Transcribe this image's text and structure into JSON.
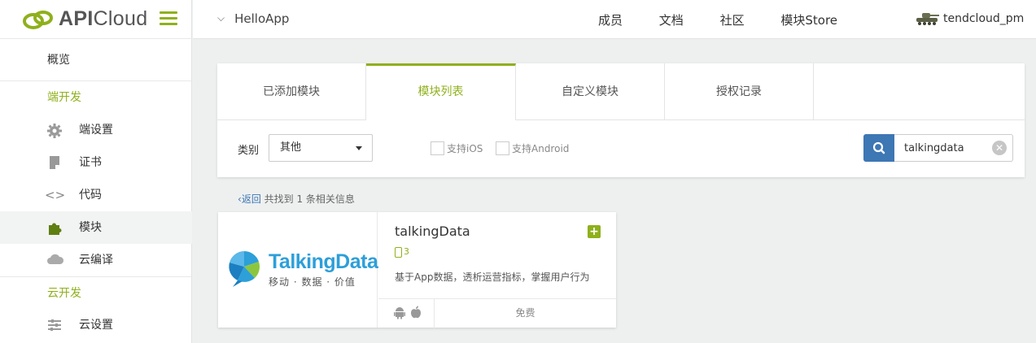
{
  "brand": {
    "logo_text_bold": "API",
    "logo_text_light": "Cloud",
    "accent": "#8fb01c"
  },
  "header": {
    "app_name": "HelloApp",
    "nav": [
      "成员",
      "文档",
      "社区",
      "模块Store"
    ],
    "username": "tendcloud_pm"
  },
  "sidebar": {
    "overview": "概览",
    "section_client": "端开发",
    "client_items": [
      {
        "label": "端设置",
        "icon": "gear-icon"
      },
      {
        "label": "证书",
        "icon": "certificate-icon"
      },
      {
        "label": "代码",
        "icon": "code-icon"
      },
      {
        "label": "模块",
        "icon": "puzzle-icon"
      },
      {
        "label": "云编译",
        "icon": "cloud-icon"
      }
    ],
    "section_cloud": "云开发",
    "cloud_items": [
      {
        "label": "云设置",
        "icon": "sliders-icon"
      }
    ]
  },
  "tabs": [
    "已添加模块",
    "模块列表",
    "自定义模块",
    "授权记录"
  ],
  "active_tab": "模块列表",
  "filter": {
    "category_label": "类别",
    "category_value": "其他",
    "support_ios": "支持iOS",
    "support_android": "支持Android",
    "search_value": "talkingdata"
  },
  "results": {
    "back": "返回",
    "summary": "共找到 1 条相关信息"
  },
  "module_card": {
    "logo_name": "TalkingData",
    "logo_tagline": "移动 · 数据 · 价值",
    "title": "talkingData",
    "count": "3",
    "description": "基于App数据，透析运营指标，掌握用户行为",
    "price": "免费",
    "platforms": [
      "android-icon",
      "apple-icon"
    ]
  }
}
